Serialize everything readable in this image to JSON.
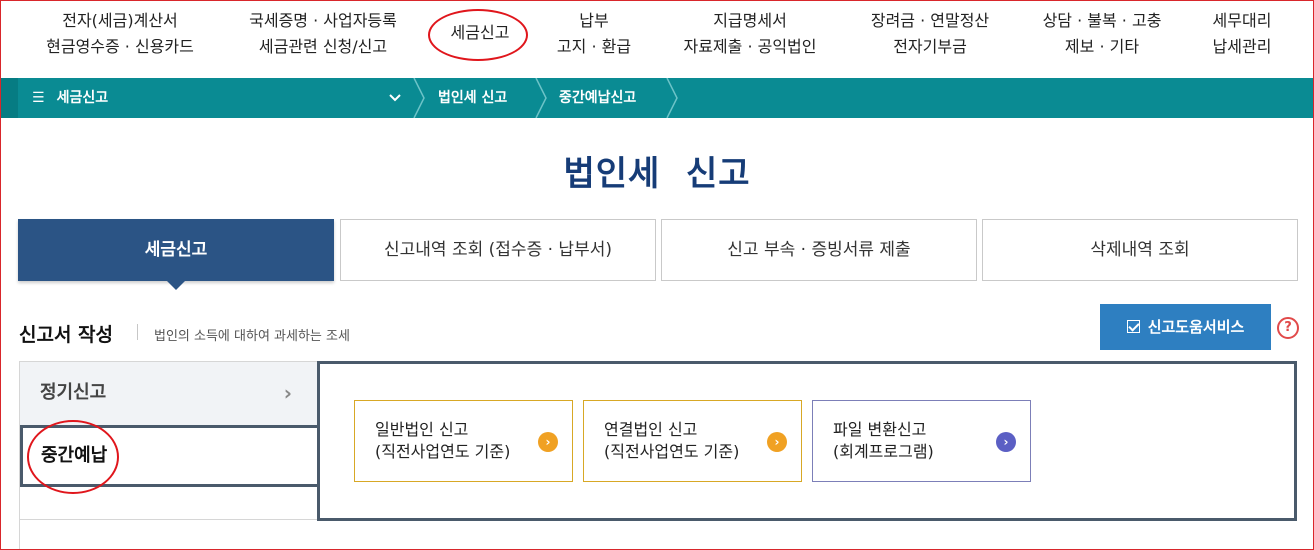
{
  "top_menu": [
    {
      "line1": "전자(세금)계산서",
      "line2": "현금영수증 · 신용카드"
    },
    {
      "line1": "국세증명 · 사업자등록",
      "line2": "세금관련 신청/신고"
    },
    {
      "line1": "세금신고",
      "line2": ""
    },
    {
      "line1": "납부",
      "line2": "고지 · 환급"
    },
    {
      "line1": "지급명세서",
      "line2": "자료제출 · 공익법인"
    },
    {
      "line1": "장려금 · 연말정산",
      "line2": "전자기부금"
    },
    {
      "line1": "상담 · 불복 · 고충",
      "line2": "제보 · 기타"
    },
    {
      "line1": "세무대리",
      "line2": "납세관리"
    }
  ],
  "breadcrumb": {
    "menu_icon": "hamburger-icon",
    "menu_label": "세금신고",
    "items": [
      "법인세 신고",
      "중간예납신고"
    ]
  },
  "page_title": "법인세  신고",
  "tabs": [
    {
      "label": "세금신고",
      "active": true
    },
    {
      "label": "신고내역 조회 (접수증 · 납부서)",
      "active": false
    },
    {
      "label": "신고 부속 · 증빙서류 제출",
      "active": false
    },
    {
      "label": "삭제내역 조회",
      "active": false
    }
  ],
  "section": {
    "title": "신고서 작성",
    "description": "법인의 소득에 대하여 과세하는 조세",
    "help_button": "신고도움서비스",
    "help_icon": "?"
  },
  "side_menu": [
    {
      "label": "정기신고",
      "arrow": "›"
    },
    {
      "label": "중간예납",
      "selected": true
    }
  ],
  "cards": [
    {
      "line1": "일반법인 신고",
      "line2": "(직전사업연도 기준)",
      "arrow": "›"
    },
    {
      "line1": "연결법인 신고",
      "line2": "(직전사업연도 기준)",
      "arrow": "›"
    },
    {
      "line1": "파일 변환신고",
      "line2": "(회계프로그램)",
      "arrow": "›"
    }
  ],
  "colors": {
    "teal_bar": "#0a8b93",
    "navy": "#2b5485",
    "title": "#163c77",
    "help_button": "#2e7fc1",
    "orange": "#f0a123",
    "purple": "#5b5fc4",
    "annotation_red": "#e0161c"
  }
}
